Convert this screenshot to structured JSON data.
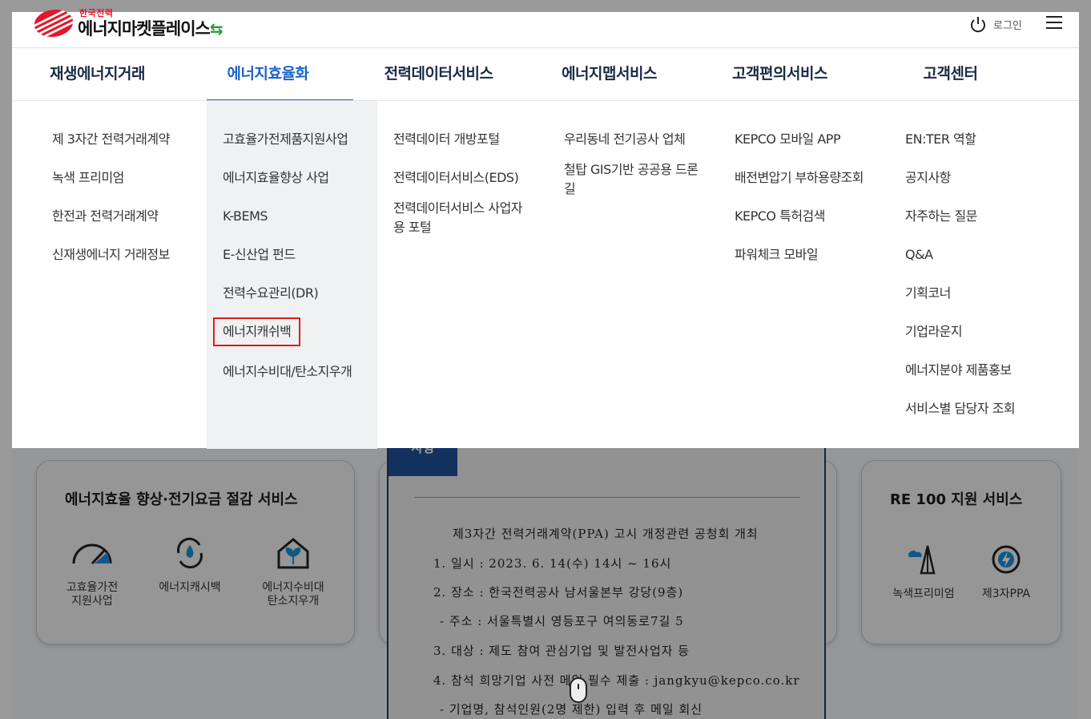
{
  "logo": {
    "small": "한국전력",
    "big": "에너지마켓플레이스"
  },
  "header": {
    "login_label": "로그인",
    "menu_icon": "hamburger-icon",
    "power_icon": "power-icon"
  },
  "gnb": [
    "재생에너지거래",
    "에너지효율화",
    "전력데이터서비스",
    "에너지맵서비스",
    "고객편의서비스",
    "고객센터"
  ],
  "gnb_active": "에너지효율화",
  "mega_menu": [
    [
      "제 3자간 전력거래계약",
      "녹색 프리미엄",
      "한전과 전력거래계약",
      "신재생에너지 거래정보"
    ],
    [
      "고효율가전제품지원사업",
      "에너지효율향상 사업",
      "K-BEMS",
      "E-신산업 펀드",
      "전력수요관리(DR)",
      "에너지캐쉬백",
      "에너지수비대/탄소지우개"
    ],
    [
      "전력데이터 개방포털",
      "전력데이터서비스(EDS)",
      "전력데이터서비스 사업자용 포털"
    ],
    [
      "우리동네 전기공사 업체",
      "철탑 GIS기반 공공용 드론길"
    ],
    [
      "KEPCO 모바일 APP",
      "배전변압기 부하용량조회",
      "KEPCO 특허검색",
      "파워체크 모바일"
    ],
    [
      "EN:TER 역할",
      "공지사항",
      "자주하는 질문",
      "Q&A",
      "기획코너",
      "기업라운지",
      "에너지분야 제품홍보",
      "서비스별 담당자 조회"
    ]
  ],
  "highlighted_item": "에너지캐쉬백",
  "card_efficiency": {
    "title": "에너지효율 향상·전기요금 절감 서비스",
    "items": [
      {
        "label1": "고효율가전",
        "label2": "지원사업",
        "icon": "gauge-icon"
      },
      {
        "label1": "에너지캐시백",
        "label2": "",
        "icon": "water-drop-cycle-icon"
      },
      {
        "label1": "에너지수비대",
        "label2": "탄소지우개",
        "icon": "house-leaf-icon"
      }
    ]
  },
  "card_re100": {
    "title": "RE 100 지원 서비스",
    "items": [
      {
        "label": "녹색프리미엄",
        "icon": "wind-turbine-icon"
      },
      {
        "label": "제3자PPA",
        "icon": "lightning-icon"
      }
    ]
  },
  "popup": {
    "tab_label": "사항",
    "lines": [
      "제3자간 전력거래계약(PPA) 고시 개정관련 공청회 개최",
      "1. 일시 : 2023. 6. 14(수) 14시 ~ 16시",
      "2. 장소 : 한국전력공사 남서울본부 강당(9층)",
      " - 주소 : 서울특별시 영등포구 여의동로7길 5",
      "3. 대상 : 제도 참여 관심기업 및 발전사업자 등",
      "4. 참석 희망기업 사전 메일 필수 제출 : jangkyu@kepco.co.kr",
      " - 기업명, 참석인원(2명 제한) 입력 후 메일 회신"
    ]
  }
}
